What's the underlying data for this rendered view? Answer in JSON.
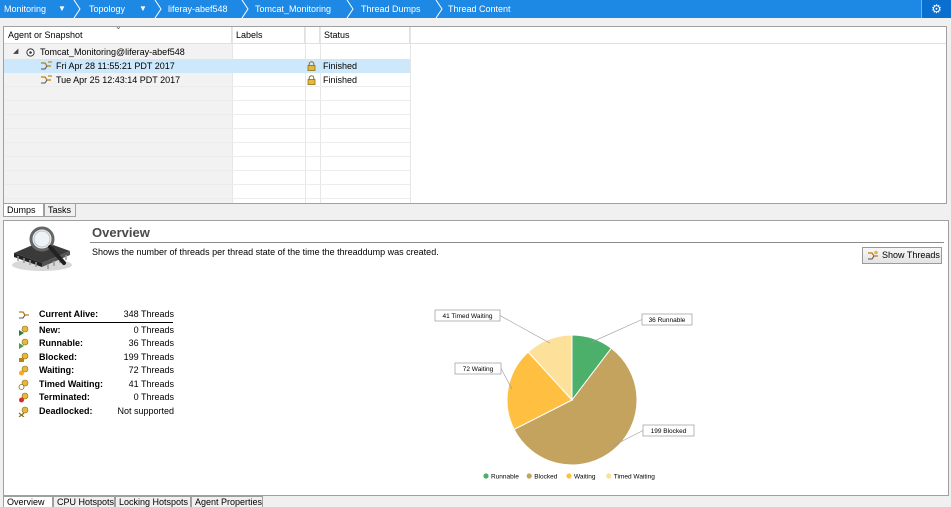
{
  "breadcrumb": {
    "items": [
      {
        "label": "Monitoring",
        "has_dropdown": true
      },
      {
        "label": "Topology",
        "has_dropdown": true
      },
      {
        "label": "liferay-abef548",
        "has_dropdown": false
      },
      {
        "label": "Tomcat_Monitoring",
        "has_dropdown": false
      },
      {
        "label": "Thread Dumps",
        "has_dropdown": false
      },
      {
        "label": "Thread Content",
        "has_dropdown": false
      }
    ],
    "gear_icon": "gear-icon",
    "bar_color": "#1e88e5"
  },
  "tree": {
    "columns": [
      "Agent or Snapshot",
      "Labels",
      "Status"
    ],
    "root": {
      "label": "Tomcat_Monitoring@liferay-abef548"
    },
    "snapshots": [
      {
        "label": "Fri Apr 28 11:55:21 PDT 2017",
        "labels": "",
        "status": "Finished",
        "selected": true
      },
      {
        "label": "Tue Apr 25 12:43:14 PDT 2017",
        "labels": "",
        "status": "Finished",
        "selected": false
      }
    ]
  },
  "top_tabs": [
    "Dumps",
    "Tasks"
  ],
  "overview": {
    "title": "Overview",
    "description": "Shows the number of threads per thread state of the time the threaddump was created.",
    "show_threads_label": "Show Threads",
    "stats": [
      {
        "label": "Current Alive:",
        "value": "348 Threads"
      },
      {
        "label": "New:",
        "value": "0 Threads"
      },
      {
        "label": "Runnable:",
        "value": "36 Threads"
      },
      {
        "label": "Blocked:",
        "value": "199 Threads"
      },
      {
        "label": "Waiting:",
        "value": "72 Threads"
      },
      {
        "label": "Timed Waiting:",
        "value": "41 Threads"
      },
      {
        "label": "Terminated:",
        "value": "0 Threads"
      },
      {
        "label": "Deadlocked:",
        "value": "Not supported"
      }
    ]
  },
  "chart_data": {
    "type": "pie",
    "categories": [
      "Runnable",
      "Blocked",
      "Waiting",
      "Timed Waiting"
    ],
    "values": [
      36,
      199,
      72,
      41
    ],
    "slice_labels": [
      "36 Runnable",
      "199 Blocked",
      "72 Waiting",
      "41 Timed Waiting"
    ],
    "colors": [
      "#4caf6a",
      "#c4a35e",
      "#ffc042",
      "#fde09a"
    ],
    "legend_position": "bottom"
  },
  "bottom_tabs": [
    "Overview",
    "CPU Hotspots",
    "Locking Hotspots",
    "Agent Properties"
  ]
}
